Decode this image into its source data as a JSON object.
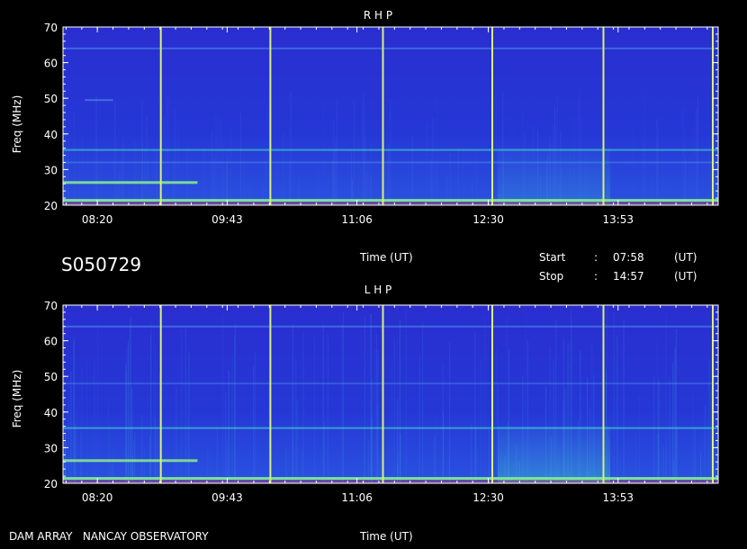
{
  "header": {
    "station_id": "S050729",
    "time_label_mid": "Time (UT)",
    "time_label_bottom": "Time (UT)",
    "start_label": "Start",
    "stop_label": "Stop",
    "sep": ":",
    "start_time": "07:58",
    "stop_time": "14:57",
    "unit": "(UT)"
  },
  "footer": {
    "credit": "DAM ARRAY   NANCAY OBSERVATORY"
  },
  "colors": {
    "background": "#000000",
    "spectrum_base": "#2438d8",
    "emission_strong": "#30e0c0",
    "marker_line": "#d0f080",
    "axis": "#ffffff"
  },
  "chart_data": [
    {
      "type": "heatmap",
      "title": "R H P",
      "ylabel": "Freq (MHz)",
      "xlabel": "Time (UT)",
      "ylim": [
        20,
        70
      ],
      "yticks": [
        "20",
        "30",
        "40",
        "50",
        "60",
        "70"
      ],
      "xticks": [
        "08:20",
        "09:43",
        "11:06",
        "12:30",
        "13:53"
      ],
      "xtick_values": [
        8.333,
        9.717,
        11.1,
        12.5,
        13.883
      ],
      "xlim": [
        7.967,
        14.95
      ],
      "calibration_markers_ut": [
        9.0,
        10.167,
        11.367,
        12.533,
        13.717,
        14.883
      ],
      "emission_bands": [
        {
          "freq": 21.5,
          "t0": 7.97,
          "t1": 14.95,
          "level": 0.9
        },
        {
          "freq": 26.5,
          "t0": 7.97,
          "t1": 9.4,
          "level": 0.85
        },
        {
          "freq": 35.5,
          "t0": 7.97,
          "t1": 14.95,
          "level": 0.6
        },
        {
          "freq": 32.0,
          "t0": 7.97,
          "t1": 14.95,
          "level": 0.35
        },
        {
          "freq": 64.0,
          "t0": 7.97,
          "t1": 14.95,
          "level": 0.45
        },
        {
          "freq": 49.5,
          "t0": 8.2,
          "t1": 8.5,
          "level": 0.5
        }
      ]
    },
    {
      "type": "heatmap",
      "title": "L H P",
      "ylabel": "Freq (MHz)",
      "xlabel": "Time (UT)",
      "ylim": [
        20,
        70
      ],
      "yticks": [
        "20",
        "30",
        "40",
        "50",
        "60",
        "70"
      ],
      "xticks": [
        "08:20",
        "09:43",
        "11:06",
        "12:30",
        "13:53"
      ],
      "xtick_values": [
        8.333,
        9.717,
        11.1,
        12.5,
        13.883
      ],
      "xlim": [
        7.967,
        14.95
      ],
      "calibration_markers_ut": [
        9.0,
        10.167,
        11.367,
        12.533,
        13.717,
        14.883
      ],
      "emission_bands": [
        {
          "freq": 21.5,
          "t0": 7.97,
          "t1": 14.95,
          "level": 0.9
        },
        {
          "freq": 26.5,
          "t0": 7.97,
          "t1": 9.4,
          "level": 0.85
        },
        {
          "freq": 35.5,
          "t0": 7.97,
          "t1": 14.95,
          "level": 0.6
        },
        {
          "freq": 48.0,
          "t0": 7.97,
          "t1": 14.95,
          "level": 0.3
        },
        {
          "freq": 64.0,
          "t0": 7.97,
          "t1": 14.95,
          "level": 0.45
        }
      ]
    }
  ]
}
